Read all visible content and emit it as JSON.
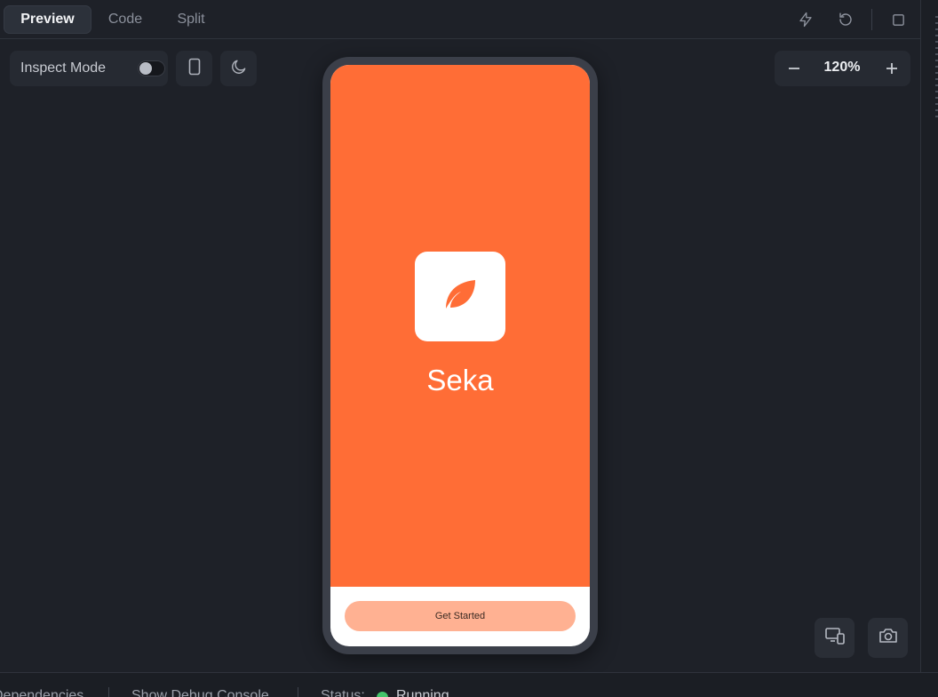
{
  "tabs": [
    {
      "label": "Preview",
      "active": true
    },
    {
      "label": "Code",
      "active": false
    },
    {
      "label": "Split",
      "active": false
    }
  ],
  "top_icons": [
    "lightning-icon",
    "refresh-icon",
    "square-icon"
  ],
  "toolbar": {
    "inspect_label": "Inspect Mode",
    "inspect_enabled": false,
    "device_icon": "phone-icon",
    "theme_icon": "moon-icon"
  },
  "zoom": {
    "value": "120%",
    "minus": "−",
    "plus": "+"
  },
  "phone_app": {
    "name": "Seka",
    "cta": "Get Started",
    "brand_color": "#ff6d36",
    "cta_color": "#ffb192",
    "logo_icon": "leaf-icon"
  },
  "floating_buttons": [
    "responsive-devices-icon",
    "camera-icon"
  ],
  "statusbar": {
    "dependencies": "Dependencies",
    "debug": "Show Debug Console",
    "status_label": "Status:",
    "status_value": "Running",
    "status_color": "#44c46b"
  }
}
